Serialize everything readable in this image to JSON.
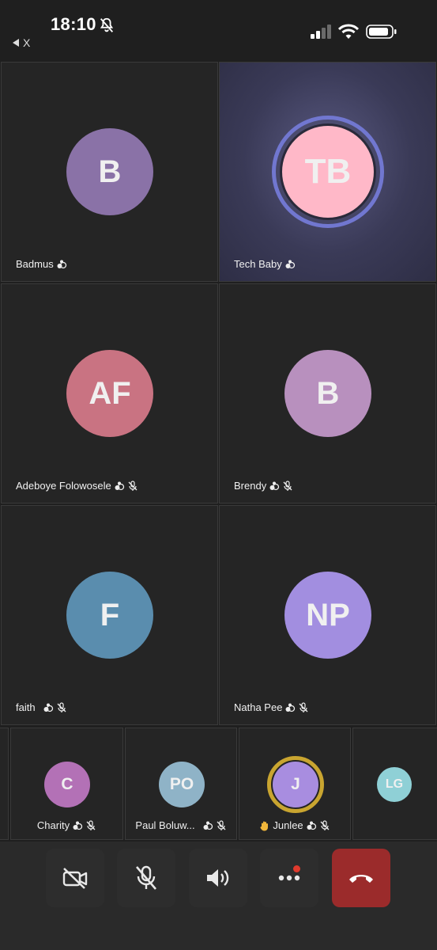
{
  "status_bar": {
    "time": "18:10",
    "back_label": "X"
  },
  "participants": [
    {
      "initials": "B",
      "name": "Badmus",
      "color": "#8a72a7",
      "muted": false
    },
    {
      "initials": "TB",
      "name": "Tech Baby",
      "color": "#ffb8c8",
      "muted": false,
      "speaking": true
    },
    {
      "initials": "AF",
      "name": "Adeboye Folowosele",
      "color": "#c97382",
      "muted": true
    },
    {
      "initials": "B",
      "name": "Brendy",
      "color": "#b890be",
      "muted": true
    },
    {
      "initials": "F",
      "name": "faith",
      "color": "#5a8dae",
      "muted": true
    },
    {
      "initials": "NP",
      "name": "Natha Pee",
      "color": "#a28ee0",
      "muted": true
    }
  ],
  "strip": [
    {
      "initials": "C",
      "name": "Charity",
      "color": "#b371b6"
    },
    {
      "initials": "PO",
      "name": "Paul Boluw...",
      "color": "#8fb3c7"
    },
    {
      "initials": "J",
      "name": "Junlee",
      "color": "#a88de0",
      "hand_raised": true
    },
    {
      "initials": "LG",
      "name": "",
      "color": "#8fd0d6"
    }
  ],
  "toolbar": {
    "camera": "camera-off-icon",
    "mic": "mic-off-icon",
    "speaker": "speaker-icon",
    "more": "more-icon",
    "end": "end-call-icon"
  },
  "colors": {
    "background": "#1f1f1f",
    "tile": "#252525",
    "end_call": "#9b2b2b",
    "speaking_ring": "#7177d0",
    "hand_ring": "#c9a530"
  }
}
